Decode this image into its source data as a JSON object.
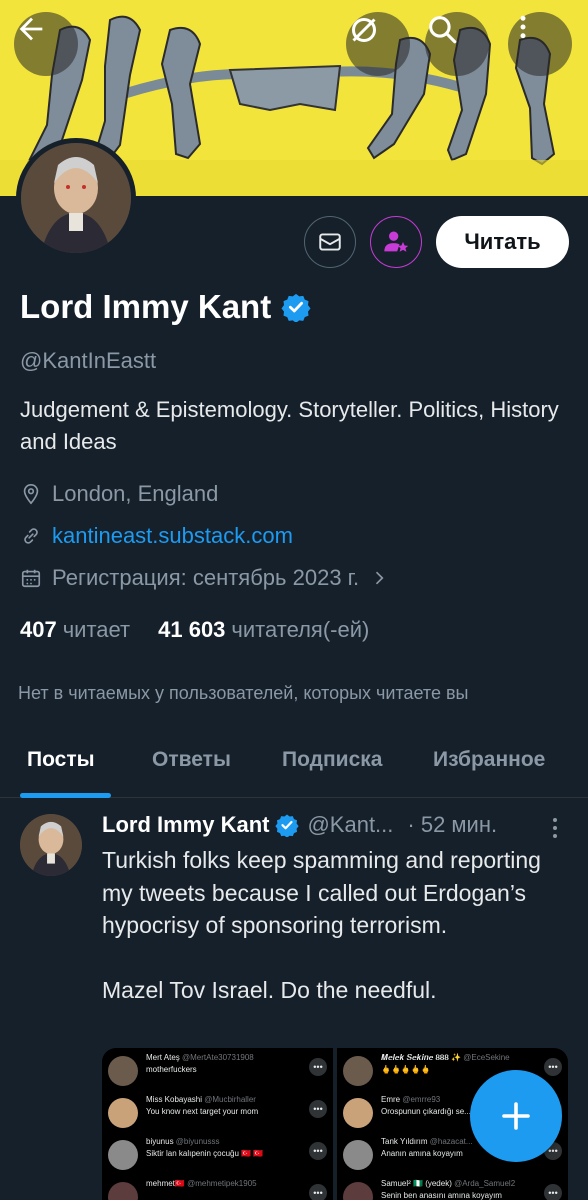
{
  "colors": {
    "background": "#15202b",
    "accent": "#1d9bf0",
    "banner": "#f2e43a",
    "subscribe_ring": "#c73bd6"
  },
  "header": {
    "back_icon": "arrow-left-icon",
    "translate_icon": "no-translate-icon",
    "search_icon": "search-icon",
    "more_icon": "more-vertical-icon"
  },
  "profile": {
    "name": "Lord Immy Kant",
    "verified_icon": "verified-badge-icon",
    "handle": "@KantInEastt",
    "bio": "Judgement & Epistemology. Storyteller. Politics, History and Ideas",
    "location": "London, England",
    "website": "kantineast.substack.com",
    "joined": "Регистрация: сентябрь 2023 г.",
    "follow_label": "Читать",
    "following_count": "407",
    "following_label": "читает",
    "followers_count": "41 603",
    "followers_label": "читателя(-ей)",
    "followed_by_note": "Нет в читаемых у пользователей, которых читаете вы"
  },
  "tabs": [
    {
      "label": "Посты",
      "active": true
    },
    {
      "label": "Ответы"
    },
    {
      "label": "Подписка"
    },
    {
      "label": "Избранное"
    }
  ],
  "post": {
    "author": "Lord Immy Kant",
    "handle": "@Kant...",
    "time": "· 52 мин.",
    "text": "Turkish folks keep spamming and reporting my tweets because I called out Erdogan’s hypocrisy of sponsoring terrorism.\n\nMazel Tov Israel. Do the needful.",
    "media_left": [
      {
        "name": "Mert Ateş",
        "handle": "@MertAte30731908",
        "text": "motherfuckers"
      },
      {
        "name": "Miss Kobayashi",
        "handle": "@Mucbirhaller",
        "text": "You know next target your mom"
      },
      {
        "name": "biyunus",
        "handle": "@biyunusss",
        "text": "Siktir lan kalıpenin çocuğu 🇹🇷 🇹🇷"
      },
      {
        "name": "mehmet🇹🇷",
        "handle": "@mehmetipek1905",
        "text": ""
      }
    ],
    "media_right": [
      {
        "name": "𝑴𝒆𝒍𝒆𝒌 𝑺𝒆𝒌𝒊𝒏𝒆 𝟖𝟖𝟖 ✨",
        "handle": "@EceSekine",
        "text": "🖕🖕🖕🖕🖕"
      },
      {
        "name": "Emre",
        "handle": "@emrre93",
        "text": "Orospunun çıkardığı se... sikeyim ben"
      },
      {
        "name": "Tank Yıldırım",
        "handle": "@hazacat...",
        "text": "Ananın amına koyayım"
      },
      {
        "name": "Samuel² 🇳🇬 (yedek)",
        "handle": "@Arda_Samuel2",
        "text": "Senin ben anasını amına koyayım"
      }
    ]
  },
  "fab_label": "+"
}
